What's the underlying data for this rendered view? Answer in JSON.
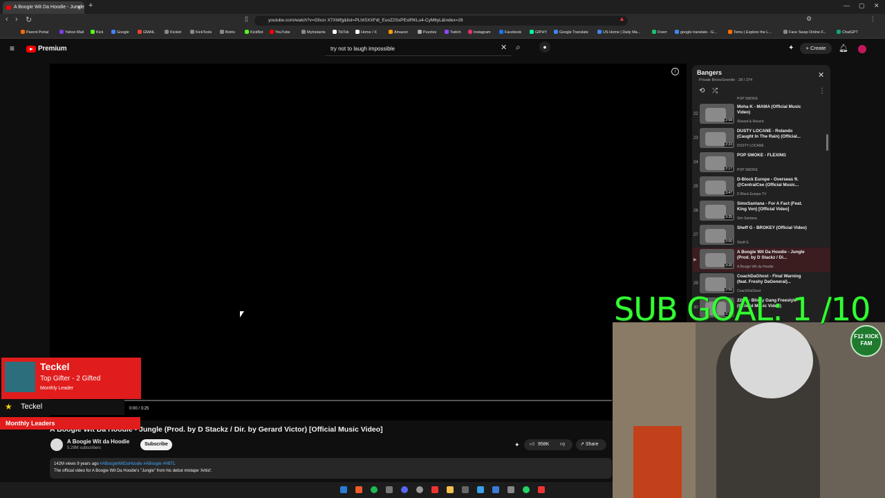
{
  "browser": {
    "tab_title": "A Boogie Wit Da Hoodie - Jungle",
    "url": "youtube.com/watch?v=Gfxcn X7XWfg&list=PLhISXXFdl_EuoZ2SxPEsIRKLu4-CyM6yL&index=28",
    "bookmarks": [
      "Parent Portal",
      "Yahoo Mail",
      "Kick",
      "Google",
      "GMAIL",
      "Kicklet",
      "KickTools",
      "Botrix",
      "KickBot",
      "YouTube",
      "MyInstants",
      "TikTok",
      "Home / X",
      "Amazon",
      "Puzzles",
      "Twitch",
      "Instagram",
      "Facebook",
      "GIPHY",
      "Google Translate",
      "US Home | Daily Ma...",
      "Fiverr",
      "google translate - G...",
      "Temu | Explore the L...",
      "Face Swap Online F...",
      "ChatGPT"
    ]
  },
  "youtube": {
    "brand": "Premium",
    "search_value": "try not to laugh impossible",
    "create_label": "Create"
  },
  "video": {
    "time": "0:00 / 3:25",
    "title": "A Boogie Wit Da Hoodie - Jungle (Prod. by D Stackz / Dir. by Gerard Victor) [Official Music Video]",
    "channel": "A Boogie Wit da Hoodie",
    "subscribers": "5.29M subscribers",
    "subscribe_label": "Subscribe",
    "likes": "958K",
    "share_label": "Share",
    "views_age": "142M views  9 years ago",
    "tags": "#ABoogieWitDaHoodie #ABoogie #HBTL",
    "description": "The official video for A Boogie Wit Da Hoodie's \"Jungle\" from his debut mixtape 'Artist'."
  },
  "playlist": {
    "title": "Bangers",
    "meta": "Private  BronzGremlin · 28 / 374",
    "prev_artist": "POP SMOKE",
    "items": [
      {
        "num": "22",
        "title": "Moha K - MAMA (Official Music Video)",
        "artist": "Slowed & Reverb",
        "dur": "2:58"
      },
      {
        "num": "23",
        "title": "DUSTY LOCANE - Rolando (Caught In The Rain) (Official...",
        "artist": "DUSTY LOCANE",
        "dur": "2:23"
      },
      {
        "num": "24",
        "title": "POP SMOKE - FLEXING",
        "artist": "POP SMOKE",
        "dur": "2:17"
      },
      {
        "num": "25",
        "title": "D-Block Europe - Overseas ft. @CentralCee (Official Music...",
        "artist": "D Block Europe TV",
        "dur": "3:47"
      },
      {
        "num": "26",
        "title": "SimxSantana - For A Fact (Feat. King Von) [Official Video]",
        "artist": "Sim Santana",
        "dur": "3:35"
      },
      {
        "num": "27",
        "title": "Sheff G - BROKEY (Official Video)",
        "artist": "Sheff G",
        "dur": "2:00"
      },
      {
        "num": "▶",
        "title": "A Boogie Wit Da Hoodie - Jungle (Prod. by D Stackz / Di...",
        "artist": "A Boogie Wit da Hoodie",
        "dur": "3:26"
      },
      {
        "num": "29",
        "title": "CoachDaGhost - Final Warning (feat. Freshy DaGeneral)...",
        "artist": "CoachDaGhost",
        "dur": "2:56"
      },
      {
        "num": "30",
        "title": "22Gz - Blixky Gang Freestyle (Official Music Video)",
        "artist": "",
        "dur": "2:30"
      }
    ]
  },
  "overlay": {
    "sub_goal": "SUB GOAL: 1  /10",
    "badge": "F12 KICK FAM",
    "gifter_name": "Teckel",
    "gifter_line1": "Top Gifter - 2 Gifted",
    "gifter_line2": "Monthly Leader",
    "leader_name": "Teckel",
    "leaders_label": "Monthly Leaders",
    "gift_count": "2"
  },
  "colors": {
    "accent": "#ff0000",
    "goal": "#33ff33",
    "gifter_bg": "#e01c1c"
  }
}
